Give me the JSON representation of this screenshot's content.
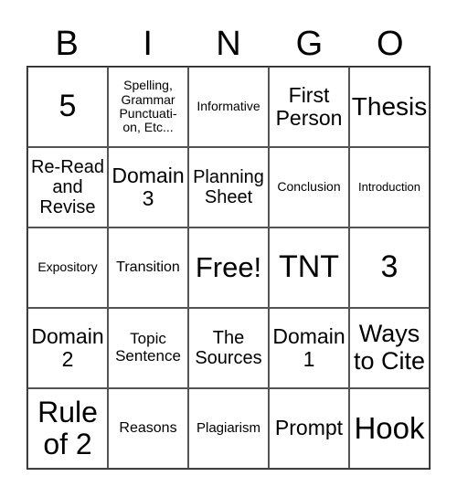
{
  "header": {
    "letters": [
      "B",
      "I",
      "N",
      "G",
      "O"
    ]
  },
  "card": {
    "rows": [
      [
        "5",
        "Spelling, Grammar Punctuati-on, Etc...",
        "Informative",
        "First Person",
        "Thesis"
      ],
      [
        "Re-Read and Revise",
        "Domain 3",
        "Planning Sheet",
        "Conclusion",
        "Introduction"
      ],
      [
        "Expository",
        "Transition",
        "Free!",
        "TNT",
        "3"
      ],
      [
        "Domain 2",
        "Topic Sentence",
        "The Sources",
        "Domain 1",
        "Ways to Cite"
      ],
      [
        "Rule of 2",
        "Reasons",
        "Plagiarism",
        "Prompt",
        "Hook"
      ]
    ]
  }
}
